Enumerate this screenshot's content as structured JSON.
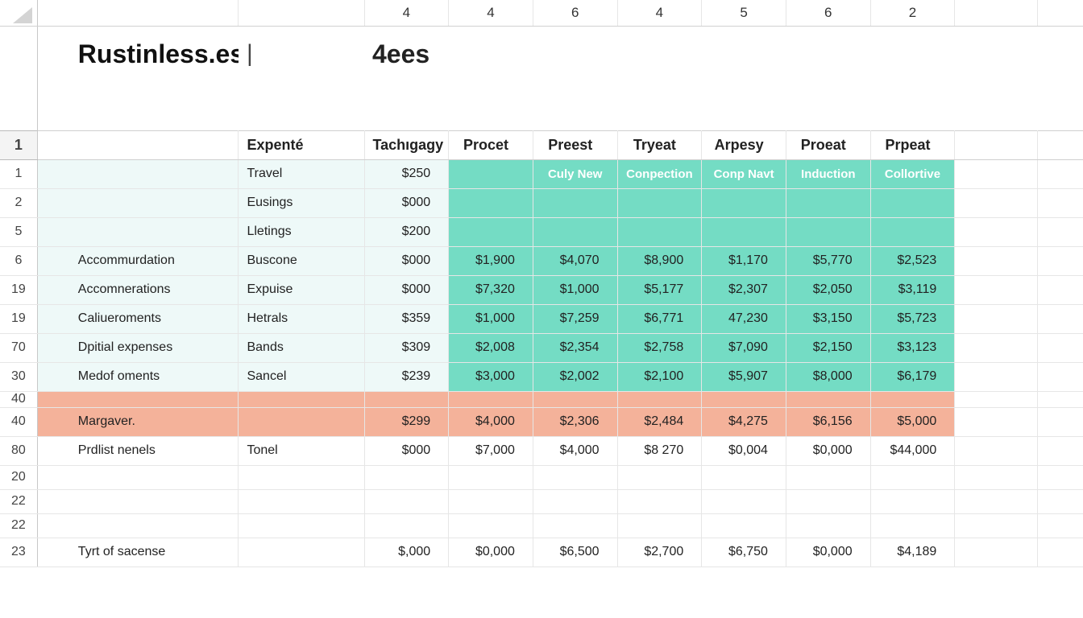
{
  "title": {
    "left": "Rustinless.es",
    "sep": "|",
    "right": "4ees"
  },
  "colhead": [
    "4",
    "4",
    "6",
    "4",
    "5",
    "6",
    "2"
  ],
  "headers": {
    "rownum": "1",
    "expente": "Expenté",
    "tachigagy": "Tachıgagy",
    "cols": [
      "Procet",
      "Preest",
      "Tryeat",
      "Arpesy",
      "Proeat",
      "Prpeat"
    ]
  },
  "subheaders": [
    "Culy New",
    "Conpection",
    "Conp Navt",
    "Induction",
    "Collortive"
  ],
  "rows": [
    {
      "rn": "1",
      "a": "",
      "b": "Travel",
      "c": "$250",
      "v": [
        "",
        "",
        "",
        "",
        "",
        ""
      ],
      "style": "mintband",
      "mint_c": false
    },
    {
      "rn": "2",
      "a": "",
      "b": "Eusings",
      "c": "$000",
      "v": [
        "",
        "",
        "",
        "",
        "",
        ""
      ],
      "style": "mintband",
      "mint_c": false
    },
    {
      "rn": "5",
      "a": "",
      "b": "Lletings",
      "c": "$200",
      "v": [
        "",
        "",
        "",
        "",
        "",
        ""
      ],
      "style": "mintband",
      "mint_c": false
    },
    {
      "rn": "6",
      "a": "Accommurdation",
      "b": "Buscone",
      "c": "$000",
      "v": [
        "$1,900",
        "$4,070",
        "$8,900",
        "$1,170",
        "$5,770",
        "$2,523"
      ],
      "style": "mint",
      "mint_c": false
    },
    {
      "rn": "19",
      "a": "Accomnerations",
      "b": "Expuise",
      "c": "$000",
      "v": [
        "$7,320",
        "$1,000",
        "$5,177",
        "$2,307",
        "$2,050",
        "$3,119"
      ],
      "style": "mint",
      "mint_c": false
    },
    {
      "rn": "19",
      "a": "Caliueroments",
      "b": "Hetrals",
      "c": "$359",
      "v": [
        "$1,000",
        "$7,259",
        "$6,771",
        "47,230",
        "$3,150",
        "$5,723"
      ],
      "style": "mint",
      "mint_c": false
    },
    {
      "rn": "70",
      "a": "Dpitial expenses",
      "b": "Bands",
      "c": "$309",
      "v": [
        "$2,008",
        "$2,354",
        "$2,758",
        "$7,090",
        "$2,150",
        "$3,123"
      ],
      "style": "mint",
      "mint_c": false
    },
    {
      "rn": "30",
      "a": "Medof oments",
      "b": "Sancel",
      "c": "$239",
      "v": [
        "$3,000",
        "$2,002",
        "$2,100",
        "$5,907",
        "$8,000",
        "$6,179"
      ],
      "style": "mint",
      "mint_c": false
    },
    {
      "rn": "40",
      "a": "",
      "b": "",
      "c": "",
      "v": [
        "",
        "",
        "",
        "",
        "",
        ""
      ],
      "style": "salmon_tiny",
      "mint_c": false
    },
    {
      "rn": "40",
      "a": "Margaver.",
      "b": "",
      "c": "$299",
      "v": [
        "$4,000",
        "$2,306",
        "$2,484",
        "$4,275",
        "$6,156",
        "$5,000"
      ],
      "style": "salmon",
      "mint_c": false
    },
    {
      "rn": "80",
      "a": "Prdlist nenels",
      "b": "Tonel",
      "c": "$000",
      "v": [
        "$7,000",
        "$4,000",
        "$8 270",
        "$0,004",
        "$0,000",
        "$44,000"
      ],
      "style": "white",
      "mint_c": false
    },
    {
      "rn": "20",
      "a": "",
      "b": "",
      "c": "",
      "v": [
        "",
        "",
        "",
        "",
        "",
        ""
      ],
      "style": "white_short",
      "mint_c": false
    },
    {
      "rn": "22",
      "a": "",
      "b": "",
      "c": "",
      "v": [
        "",
        "",
        "",
        "",
        "",
        ""
      ],
      "style": "white_short",
      "mint_c": false
    },
    {
      "rn": "22",
      "a": "",
      "b": "",
      "c": "",
      "v": [
        "",
        "",
        "",
        "",
        "",
        ""
      ],
      "style": "white_short",
      "mint_c": false
    },
    {
      "rn": "23",
      "a": "Tyrt of sacense",
      "b": "",
      "c": "$,000",
      "v": [
        "$0,000",
        "$6,500",
        "$2,700",
        "$6,750",
        "$0,000",
        "$4,189"
      ],
      "style": "white",
      "mint_c": false
    }
  ]
}
